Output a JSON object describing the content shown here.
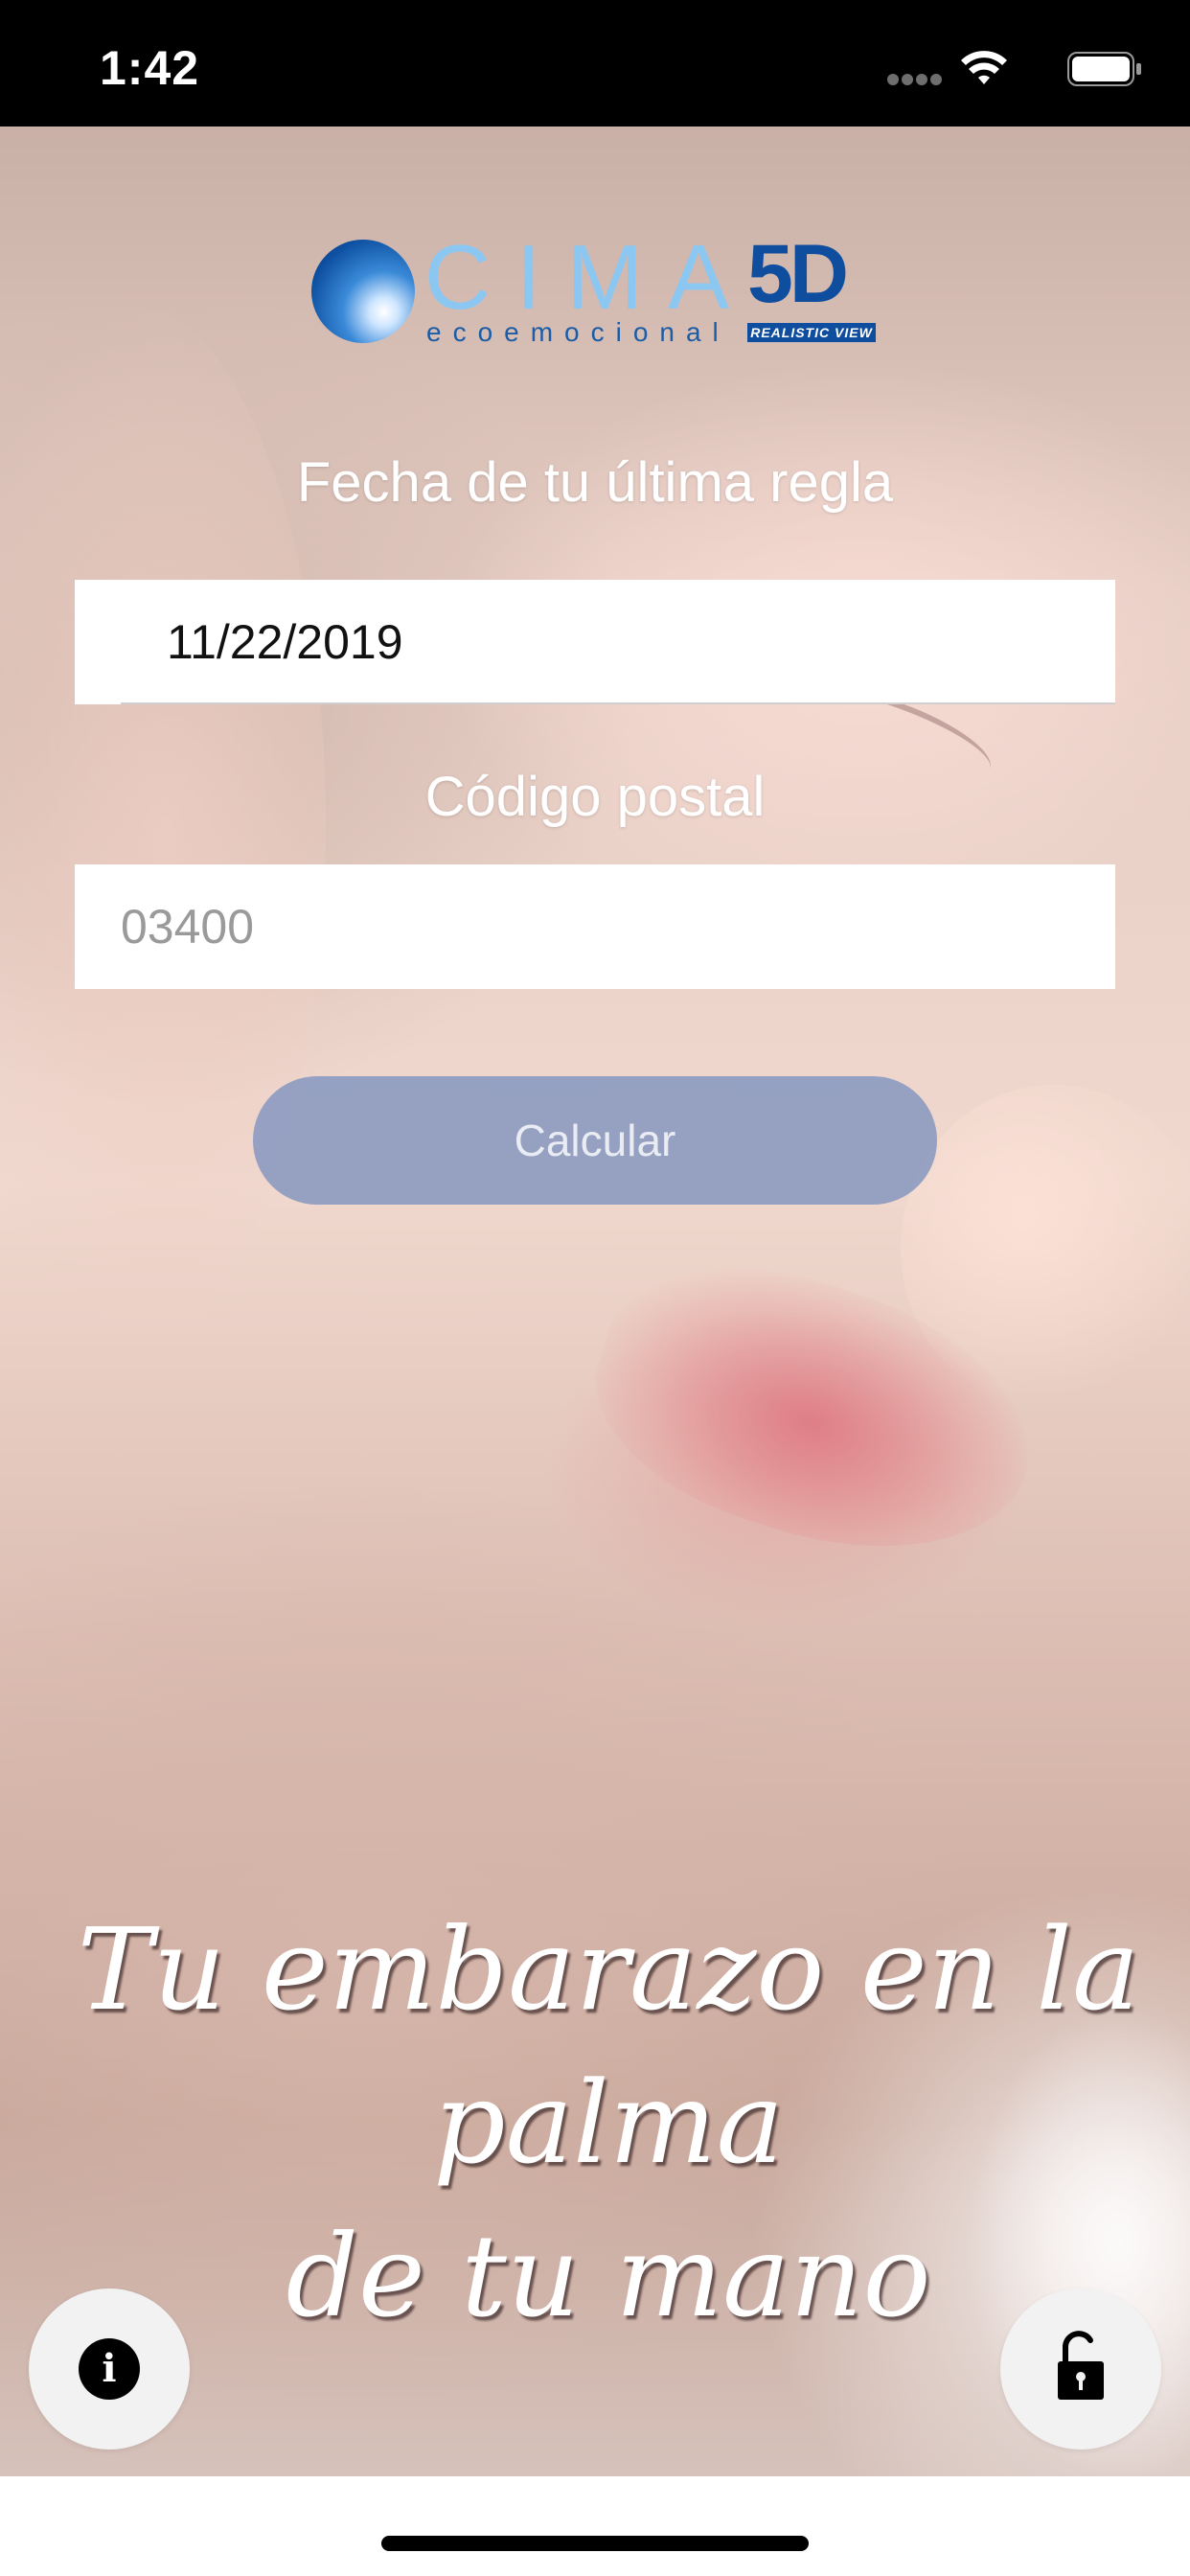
{
  "status_bar": {
    "time": "1:42"
  },
  "logo": {
    "brand": "CIMA",
    "brand_suffix": "5D",
    "subtitle": "ecoemocional",
    "tag": "REALISTIC VIEW"
  },
  "form": {
    "date_label": "Fecha de tu última regla",
    "date_value": "11/22/2019",
    "zip_label": "Código postal",
    "zip_placeholder": "03400",
    "submit_label": "Calcular"
  },
  "tagline": {
    "line1": "Tu embarazo en la palma",
    "line2": "de tu mano"
  },
  "actions": {
    "info_icon_glyph": "i",
    "info_icon": "info-icon",
    "lock_icon": "unlock-icon"
  },
  "colors": {
    "button": "#738cbe",
    "logo_light": "#8cc7f2",
    "logo_dark": "#0f4d9e"
  }
}
